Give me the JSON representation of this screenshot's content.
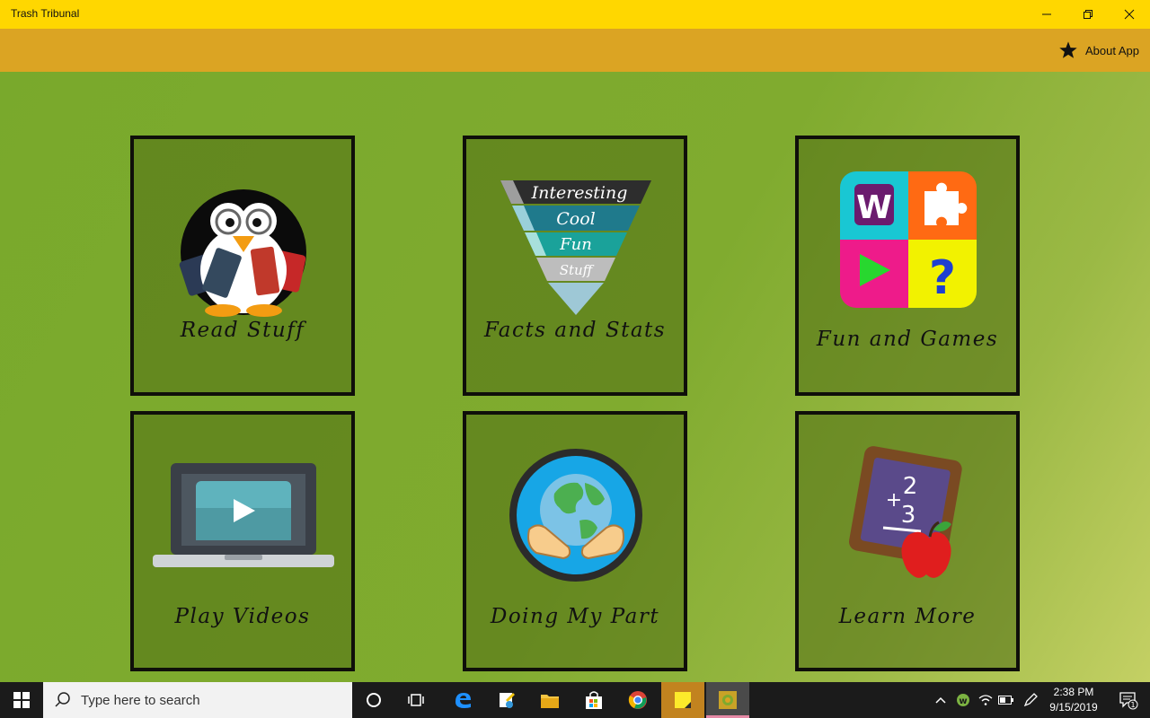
{
  "window": {
    "title": "Trash Tribunal"
  },
  "command_bar": {
    "about_label": "About App"
  },
  "tiles": [
    {
      "label": "Read Stuff"
    },
    {
      "label": "Facts and Stats",
      "pyramid": [
        "Interesting",
        "Cool",
        "Fun",
        "Stuff"
      ]
    },
    {
      "label": "Fun and Games",
      "letter": "W",
      "question": "?"
    },
    {
      "label": "Play Videos"
    },
    {
      "label": "Doing My Part"
    },
    {
      "label": "Learn More",
      "slate_top": "2",
      "slate_plus": "+",
      "slate_bottom": "3"
    }
  ],
  "taskbar": {
    "search_placeholder": "Type here to search",
    "time": "2:38 PM",
    "date": "9/15/2019",
    "notification_count": "1"
  },
  "colors": {
    "titlebar": "#ffd700",
    "command_bar": "#dba423",
    "content_green": "#7faa2e",
    "tile_border": "#0f0f0a"
  }
}
